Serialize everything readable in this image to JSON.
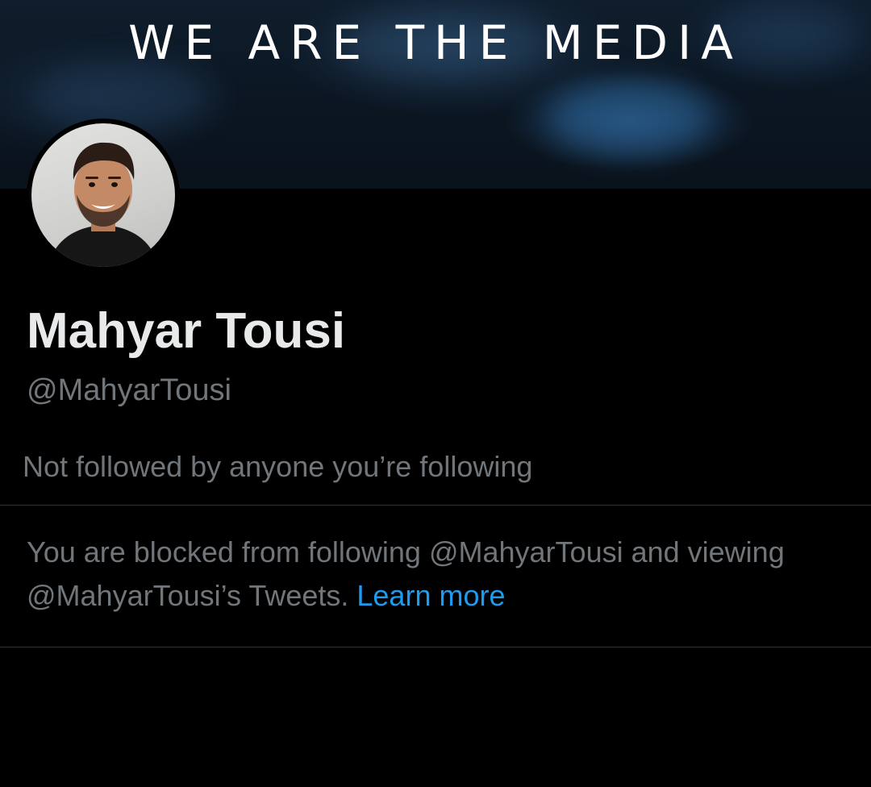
{
  "banner": {
    "title": "WE ARE THE MEDIA"
  },
  "profile": {
    "display_name": "Mahyar Tousi",
    "handle": "@MahyarTousi",
    "followers_you_know": "Not followed by anyone you’re following"
  },
  "blocked_notice": {
    "message": "You are blocked from following @MahyarTousi and viewing @MahyarTousi’s Tweets.",
    "link_label": "Learn more"
  },
  "colors": {
    "background": "#000000",
    "primary_text": "#e7e9ea",
    "secondary_text": "#71767b",
    "link": "#1d9bf0",
    "divider": "#2f3336"
  }
}
